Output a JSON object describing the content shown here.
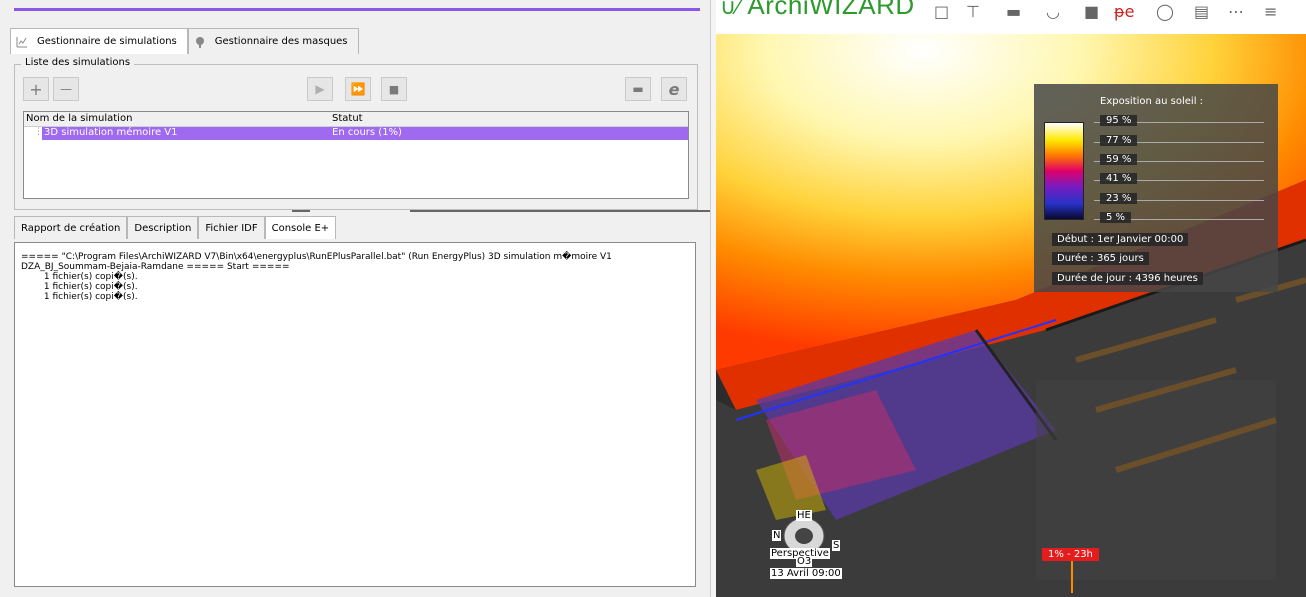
{
  "left_panel": {
    "main_tabs": [
      {
        "label": "Gestionnaire de simulations",
        "icon": "chart-icon"
      },
      {
        "label": "Gestionnaire des masques",
        "icon": "mask-icon"
      }
    ],
    "group_label": "Liste des simulations",
    "toolbar": {
      "add": "+",
      "remove": "—",
      "play": "▶",
      "play_all": "⏩",
      "stop": "■",
      "folder": "▬",
      "energyplus": "e"
    },
    "table": {
      "columns": [
        "Nom de la simulation",
        "Statut"
      ],
      "rows": [
        {
          "name": "3D simulation mémoire V1",
          "status": "En cours (1%)"
        }
      ]
    },
    "bottom_tabs": [
      "Rapport de création",
      "Description",
      "Fichier IDF",
      "Console E+"
    ],
    "console_text": "===== \"C:\\Program Files\\ArchiWIZARD V7\\Bin\\x64\\energyplus\\RunEPlusParallel.bat\" (Run EnergyPlus) 3D simulation m�moire V1\nDZA_BJ_Soummam-Bejaia-Ramdane ===== Start =====\n        1 fichier(s) copi�(s).\n        1 fichier(s) copi�(s).\n        1 fichier(s) copi�(s)."
  },
  "viewer": {
    "app_name": "ArchiWIZARD",
    "legend": {
      "title": "Exposition au soleil :",
      "levels": [
        "95 %",
        "77 %",
        "59 %",
        "41 %",
        "23 %",
        "5 %"
      ],
      "start": "Début : 1er Janvier 00:00",
      "duration": "Durée : 365 jours",
      "day_duration": "Durée de jour : 4396 heures"
    },
    "compass": {
      "top": "HE",
      "north": "N",
      "south": "S",
      "bottom": "O3",
      "mode": "Perspective",
      "datetime": "13 Avril 09:00"
    },
    "progress_marker": "1% - 23h",
    "colors": {
      "selection": "#9f69f0",
      "accent": "#8b57e8",
      "marker": "#e41c1c"
    }
  }
}
